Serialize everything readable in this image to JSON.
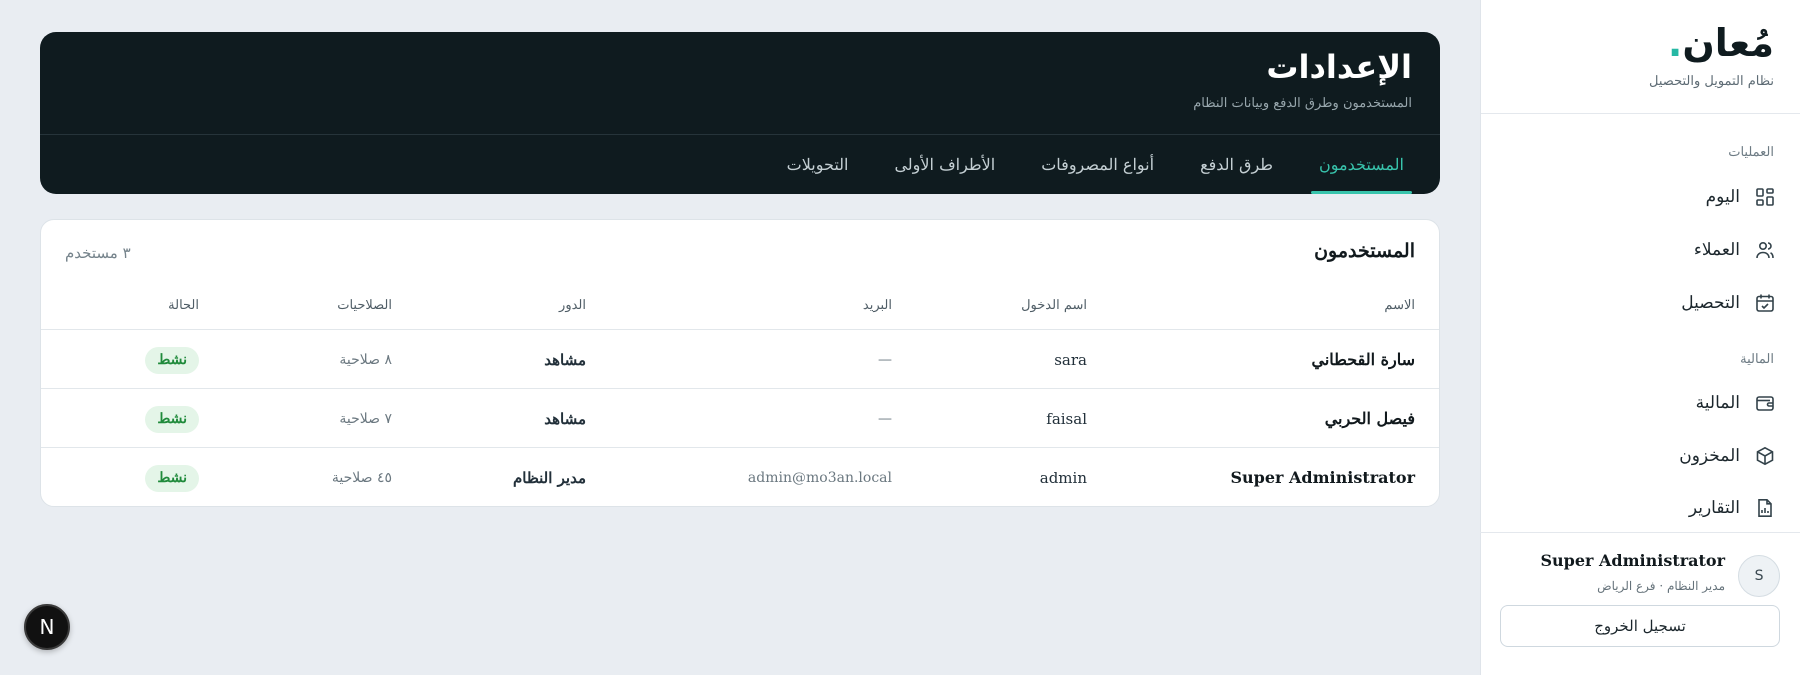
{
  "brand": {
    "logo": "مُعان",
    "dot": ".",
    "subtitle": "نظام التمويل والتحصيل"
  },
  "sidebar": {
    "sections": [
      {
        "label": "العمليات"
      },
      {
        "label": "المالية"
      }
    ],
    "items": [
      {
        "label": "اليوم",
        "icon": "dashboard-grid-icon"
      },
      {
        "label": "العملاء",
        "icon": "users-icon"
      },
      {
        "label": "التحصيل",
        "icon": "calendar-check-icon"
      },
      {
        "label": "المالية",
        "icon": "wallet-icon"
      },
      {
        "label": "المخزون",
        "icon": "box-icon"
      },
      {
        "label": "التقارير",
        "icon": "report-file-icon"
      }
    ],
    "user": {
      "initial": "S",
      "name": "Super Administrator",
      "role": "مدير النظام · فرع الرياض"
    },
    "logout_label": "تسجيل الخروج"
  },
  "header": {
    "title": "الإعدادات",
    "subtitle": "المستخدمون وطرق الدفع وبيانات النظام",
    "tabs": [
      {
        "label": "المستخدمون",
        "active": true
      },
      {
        "label": "طرق الدفع",
        "active": false
      },
      {
        "label": "أنواع المصروفات",
        "active": false
      },
      {
        "label": "الأطراف الأولى",
        "active": false
      },
      {
        "label": "التحويلات",
        "active": false
      }
    ]
  },
  "users_table": {
    "title": "المستخدمون",
    "count": "٣ مستخدم",
    "columns": [
      "الاسم",
      "اسم الدخول",
      "البريد",
      "الدور",
      "الصلاحيات",
      "الحالة"
    ],
    "rows": [
      {
        "name": "سارة القحطاني",
        "username": "sara",
        "email": "—",
        "role": "مشاهد",
        "permissions": "٨ صلاحية",
        "status": "نشط"
      },
      {
        "name": "فيصل الحربي",
        "username": "faisal",
        "email": "—",
        "role": "مشاهد",
        "permissions": "٧ صلاحية",
        "status": "نشط"
      },
      {
        "name": "Super Administrator",
        "username": "admin",
        "email": "admin@mo3an.local",
        "role": "مدير النظام",
        "permissions": "٤٥ صلاحية",
        "status": "نشط"
      }
    ]
  },
  "fab": {
    "label": "N"
  },
  "colors": {
    "accent": "#38c4ac",
    "header_bg": "#0f1b1f",
    "status_active_bg": "#e4f5e8",
    "status_active_text": "#1f8a3b"
  }
}
